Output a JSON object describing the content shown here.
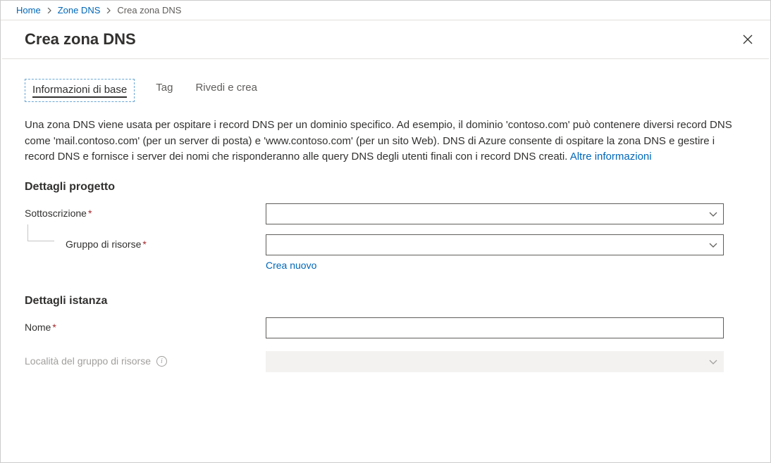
{
  "breadcrumb": {
    "home": "Home",
    "zones": "Zone DNS",
    "current": "Crea zona DNS"
  },
  "header": {
    "title": "Crea zona DNS"
  },
  "tabs": {
    "basics": "Informazioni di base",
    "tags": "Tag",
    "review": "Rivedi e crea"
  },
  "description": {
    "text": "Una zona DNS viene usata per ospitare i record DNS per un dominio specifico. Ad esempio, il dominio 'contoso.com' può contenere diversi record DNS come 'mail.contoso.com' (per un server di posta) e 'www.contoso.com' (per un sito Web). DNS di Azure consente di ospitare la zona DNS e gestire i record DNS e fornisce i server dei nomi che risponderanno alle query DNS degli utenti finali con i record DNS creati. ",
    "more_link": "Altre informazioni"
  },
  "sections": {
    "project_details": "Dettagli progetto",
    "instance_details": "Dettagli istanza"
  },
  "fields": {
    "subscription_label": "Sottoscrizione",
    "resource_group_label": "Gruppo di risorse",
    "create_new_link": "Crea nuovo",
    "name_label": "Nome",
    "rg_location_label": "Località del gruppo di risorse"
  },
  "required_marker": "*"
}
